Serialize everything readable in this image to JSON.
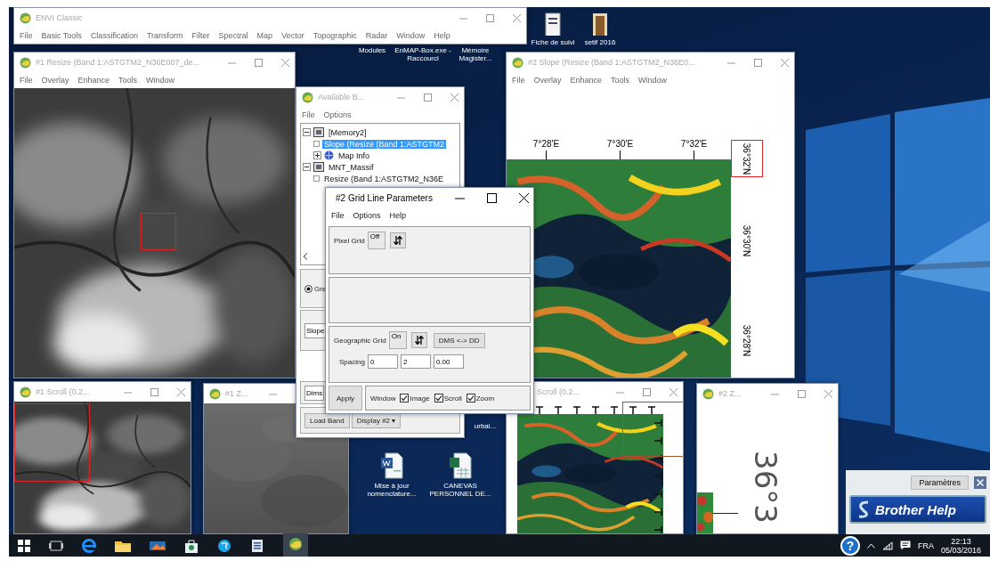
{
  "desktop": {
    "icons": [
      {
        "label": "Modules"
      },
      {
        "label": "EnMAP-Box.exe - Raccourci"
      },
      {
        "label": "Mémoire Magister..."
      },
      {
        "label": "Fiche de suivi"
      },
      {
        "label": "setif 2016"
      },
      {
        "label": "urbai..."
      },
      {
        "label": "Mise à jour nomenclature..."
      },
      {
        "label": "CANEVAS PERSONNEL DE..."
      }
    ]
  },
  "windows": [
    {
      "kind": "main",
      "title": "ENVI Classic",
      "active": false,
      "menu": [
        "File",
        "Basic Tools",
        "Classification",
        "Transform",
        "Filter",
        "Spectral",
        "Map",
        "Vector",
        "Topographic",
        "Radar",
        "Window",
        "Help"
      ]
    },
    {
      "title": "#1 Resize (Band 1:ASTGTM2_N36E007_de...",
      "active": false,
      "menu": [
        "File",
        "Overlay",
        "Enhance",
        "Tools",
        "Window"
      ]
    },
    {
      "kind": "slope",
      "title": "#2 Slope (Resize (Band 1:ASTGTM2_N36E0...",
      "active": false,
      "menu": [
        "File",
        "Overlay",
        "Enhance",
        "Tools",
        "Window"
      ],
      "lon_labels": [
        "7°28'E",
        "7°30'E",
        "7°32'E"
      ],
      "lat_labels": [
        "36°32'N",
        "36°30'N",
        "36°28'N"
      ]
    },
    {
      "kind": "scroll",
      "title": "#1 Scroll (0.2...",
      "active": false
    },
    {
      "kind": "zoom",
      "title": "#1 Z...",
      "active": false
    },
    {
      "kind": "scroll",
      "title": "Scroll (0.2...",
      "active": false
    },
    {
      "kind": "zoom",
      "title": "#2 Z...",
      "active": false,
      "label": "36°3"
    },
    {
      "kind": "bands",
      "title": "Available B...",
      "active": false,
      "menu": [
        "File",
        "Options"
      ],
      "tree": [
        {
          "kind": "file",
          "label": "[Memory2]",
          "expanded": true,
          "selected": false,
          "children": [
            {
              "kind": "band",
              "label": "Slope (Resize (Band 1:ASTGTM2",
              "selected": true
            },
            {
              "kind": "map_info",
              "label": "Map Info",
              "expanded": false,
              "selected": false
            }
          ]
        },
        {
          "kind": "file",
          "label": "MNT_Massif",
          "expanded": true,
          "selected": false,
          "children": [
            {
              "kind": "band",
              "label": "Resize (Band 1:ASTGTM2_N36E",
              "selected": false
            }
          ]
        }
      ],
      "radio": {
        "label": "Gre",
        "selected": true
      },
      "field": "Slope",
      "dims": "Dims",
      "load_button": "Load Band",
      "display_button": "Display #2 ▾"
    },
    {
      "kind": "grid",
      "title": "#2 Grid Line Parameters",
      "active": true,
      "menu": [
        "File",
        "Options",
        "Help"
      ],
      "pixel_grid": {
        "label": "Pixel Grid",
        "toggle": "Off"
      },
      "geographic_grid": {
        "label": "Geographic Grid",
        "toggle": "On",
        "convert_button": "DMS <-> DD"
      },
      "spacing": {
        "label": "Spacing",
        "fields": [
          "0",
          "2",
          "0.00"
        ]
      },
      "apply_button": "Apply",
      "window_label": "Window",
      "checkboxes": [
        {
          "label": "Image",
          "checked": true
        },
        {
          "label": "Scroll",
          "checked": true
        },
        {
          "label": "Zoom",
          "checked": true
        }
      ]
    }
  ],
  "notification": {
    "settings_button": "Paramètres",
    "banner": "Brother Help"
  },
  "taskbar": {
    "help": "?",
    "language": "FRA",
    "time": "22:13",
    "date": "05/03/2016"
  }
}
